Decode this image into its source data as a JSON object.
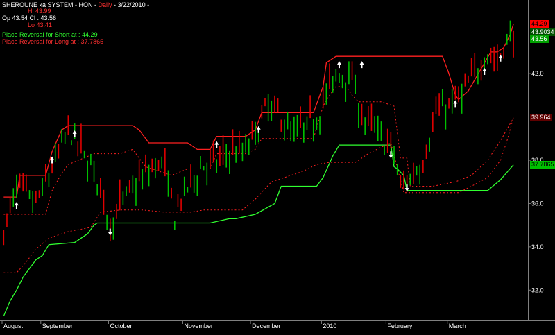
{
  "header": {
    "title_prefix": "SHEROUNE ka SYSTEM - HON - ",
    "title_period": "Daily",
    "title_date": " - 3/22/2010 -",
    "hi": "Hi 43.99",
    "op_cl": "Op 43.54  Cl : 43.56",
    "lo": "Lo 43.41",
    "short_reversal": "Place Reversal for Short at :  44.29",
    "long_reversal": "Place Reversal for Long at :  37.7865"
  },
  "colors": {
    "background": "#000000",
    "up_bar": "#00c000",
    "down_bar": "#e00000",
    "upper_stop": "#ff2020",
    "lower_stop": "#30ff30",
    "axis": "#808080",
    "arrow": "#ffffff"
  },
  "price_tags": [
    {
      "value": 44.29,
      "text": "44.29",
      "bg": "#ff0000",
      "fg": "#000000"
    },
    {
      "value": 43.9034,
      "text": "43.9034",
      "bg": "#005000",
      "fg": "#ffffff"
    },
    {
      "value": 43.56,
      "text": "43.56",
      "bg": "#00a000",
      "fg": "#ffffff"
    },
    {
      "value": 39.964,
      "text": "39.964",
      "bg": "#600000",
      "fg": "#ffffff"
    },
    {
      "value": 37.7865,
      "text": "37.7865",
      "bg": "#00c000",
      "fg": "#000000"
    }
  ],
  "chart_data": {
    "type": "line",
    "ylim": [
      30.6,
      45.4
    ],
    "y_ticks": [
      32.0,
      34.0,
      36.0,
      38.0,
      42.0
    ],
    "y_tick_labels": [
      "32.0",
      "34.0",
      "36.0",
      "38.0",
      "42.0"
    ],
    "num_bars": 163,
    "x_month_labels": [
      {
        "index": 0,
        "label": "August"
      },
      {
        "index": 12,
        "label": "September"
      },
      {
        "index": 33,
        "label": "October"
      },
      {
        "index": 56,
        "label": "November"
      },
      {
        "index": 77,
        "label": "December"
      },
      {
        "index": 99,
        "label": "2010"
      },
      {
        "index": 119,
        "label": "February"
      },
      {
        "index": 138,
        "label": "March"
      }
    ],
    "close_path": [
      {
        "i": 0,
        "v": 34.6
      },
      {
        "i": 4,
        "v": 36.8
      },
      {
        "i": 10,
        "v": 36.0
      },
      {
        "i": 14,
        "v": 37.3
      },
      {
        "i": 20,
        "v": 39.4
      },
      {
        "i": 24,
        "v": 38.5
      },
      {
        "i": 29,
        "v": 37.2
      },
      {
        "i": 33,
        "v": 35.0
      },
      {
        "i": 37,
        "v": 36.2
      },
      {
        "i": 43,
        "v": 37.2
      },
      {
        "i": 49,
        "v": 38.0
      },
      {
        "i": 53,
        "v": 35.5
      },
      {
        "i": 57,
        "v": 36.8
      },
      {
        "i": 62,
        "v": 37.8
      },
      {
        "i": 66,
        "v": 37.9
      },
      {
        "i": 71,
        "v": 38.5
      },
      {
        "i": 74,
        "v": 38.3
      },
      {
        "i": 77,
        "v": 39.0
      },
      {
        "i": 82,
        "v": 40.5
      },
      {
        "i": 86,
        "v": 40.0
      },
      {
        "i": 89,
        "v": 39.2
      },
      {
        "i": 93,
        "v": 39.5
      },
      {
        "i": 97,
        "v": 40.0
      },
      {
        "i": 101,
        "v": 41.4
      },
      {
        "i": 104,
        "v": 42.0
      },
      {
        "i": 108,
        "v": 41.8
      },
      {
        "i": 111,
        "v": 40.0
      },
      {
        "i": 115,
        "v": 39.5
      },
      {
        "i": 118,
        "v": 38.9
      },
      {
        "i": 121,
        "v": 38.4
      },
      {
        "i": 123,
        "v": 36.7
      },
      {
        "i": 126,
        "v": 37.2
      },
      {
        "i": 130,
        "v": 38.0
      },
      {
        "i": 134,
        "v": 40.2
      },
      {
        "i": 138,
        "v": 40.5
      },
      {
        "i": 142,
        "v": 41.0
      },
      {
        "i": 146,
        "v": 42.0
      },
      {
        "i": 150,
        "v": 43.0
      },
      {
        "i": 153,
        "v": 42.5
      },
      {
        "i": 157,
        "v": 43.9
      },
      {
        "i": 158,
        "v": 43.56
      }
    ],
    "series": [
      {
        "role": "upper_stop_solid",
        "points": [
          [
            0,
            36.3
          ],
          [
            4,
            36.3
          ],
          [
            5,
            37.3
          ],
          [
            13,
            37.3
          ],
          [
            15,
            38.4
          ],
          [
            18,
            39.4
          ],
          [
            20,
            39.6
          ],
          [
            40,
            39.6
          ],
          [
            42,
            39.4
          ],
          [
            45,
            38.8
          ],
          [
            52,
            38.8
          ],
          [
            57,
            38.8
          ],
          [
            60,
            38.5
          ],
          [
            64,
            38.5
          ],
          [
            66,
            39.1
          ],
          [
            75,
            39.1
          ],
          [
            78,
            39.4
          ],
          [
            80,
            40.2
          ],
          [
            90,
            40.2
          ],
          [
            96,
            40.2
          ],
          [
            99,
            41.4
          ],
          [
            100,
            42.5
          ],
          [
            103,
            42.8
          ],
          [
            127,
            42.8
          ],
          [
            136,
            42.8
          ],
          [
            138,
            42.0
          ],
          [
            140,
            41.0
          ],
          [
            141,
            40.8
          ],
          [
            144,
            41.2
          ],
          [
            151,
            43.0
          ],
          [
            153,
            43.0
          ],
          [
            155,
            43.2
          ],
          [
            157,
            43.8
          ],
          [
            158,
            44.29
          ]
        ]
      },
      {
        "role": "upper_stop_dotted",
        "points": [
          [
            0,
            35.5
          ],
          [
            13,
            35.5
          ],
          [
            15,
            36.6
          ],
          [
            18,
            37.4
          ],
          [
            20,
            37.8
          ],
          [
            28,
            38.3
          ],
          [
            36,
            38.3
          ],
          [
            40,
            38.5
          ],
          [
            44,
            37.7
          ],
          [
            52,
            37.3
          ],
          [
            57,
            37.6
          ],
          [
            60,
            37.6
          ],
          [
            64,
            37.6
          ],
          [
            66,
            38.3
          ],
          [
            75,
            38.3
          ],
          [
            78,
            38.5
          ],
          [
            80,
            39.0
          ],
          [
            89,
            39.0
          ],
          [
            96,
            39.0
          ],
          [
            99,
            40.5
          ],
          [
            101,
            41.0
          ],
          [
            103,
            41.4
          ],
          [
            106,
            41.4
          ],
          [
            108,
            41.0
          ],
          [
            110,
            40.7
          ],
          [
            117,
            40.7
          ],
          [
            121,
            40.5
          ],
          [
            123,
            38.1
          ],
          [
            125,
            38.1
          ],
          [
            126,
            36.8
          ],
          [
            133,
            36.8
          ],
          [
            140,
            37.0
          ],
          [
            145,
            37.3
          ],
          [
            150,
            38.0
          ],
          [
            154,
            38.9
          ],
          [
            158,
            39.964
          ]
        ]
      },
      {
        "role": "lower_stop_dotted",
        "points": [
          [
            0,
            32.8
          ],
          [
            4,
            32.8
          ],
          [
            7,
            33.3
          ],
          [
            10,
            33.9
          ],
          [
            14,
            34.4
          ],
          [
            20,
            34.7
          ],
          [
            27,
            34.9
          ],
          [
            30,
            35.6
          ],
          [
            36,
            35.7
          ],
          [
            43,
            35.7
          ],
          [
            50,
            35.6
          ],
          [
            54,
            35.6
          ],
          [
            58,
            35.6
          ],
          [
            62,
            35.7
          ],
          [
            68,
            35.7
          ],
          [
            74,
            35.7
          ],
          [
            78,
            36.2
          ],
          [
            83,
            37.0
          ],
          [
            89,
            37.3
          ],
          [
            93,
            37.5
          ],
          [
            97,
            37.8
          ],
          [
            101,
            37.9
          ],
          [
            109,
            37.9
          ],
          [
            113,
            38.3
          ],
          [
            117,
            38.6
          ],
          [
            120,
            38.8
          ],
          [
            124,
            36.5
          ],
          [
            141,
            36.5
          ],
          [
            145,
            36.8
          ],
          [
            150,
            37.2
          ],
          [
            154,
            38.0
          ],
          [
            156,
            38.9
          ],
          [
            158,
            39.964
          ]
        ]
      },
      {
        "role": "lower_stop_solid",
        "points": [
          [
            0,
            30.8
          ],
          [
            2,
            31.5
          ],
          [
            4,
            32.0
          ],
          [
            6,
            32.6
          ],
          [
            10,
            33.4
          ],
          [
            12,
            33.6
          ],
          [
            14,
            34.1
          ],
          [
            22,
            34.2
          ],
          [
            26,
            34.6
          ],
          [
            28,
            35.0
          ],
          [
            29,
            35.1
          ],
          [
            56,
            35.1
          ],
          [
            64,
            35.1
          ],
          [
            70,
            35.3
          ],
          [
            72,
            35.3
          ],
          [
            78,
            35.5
          ],
          [
            84,
            36.0
          ],
          [
            86,
            36.8
          ],
          [
            97,
            36.8
          ],
          [
            99,
            37.2
          ],
          [
            102,
            38.2
          ],
          [
            104,
            38.7
          ],
          [
            120,
            38.7
          ],
          [
            121,
            37.7
          ],
          [
            122,
            37.6
          ],
          [
            124,
            37.3
          ],
          [
            125,
            36.6
          ],
          [
            150,
            36.6
          ],
          [
            154,
            37.1
          ],
          [
            158,
            37.7865
          ]
        ]
      }
    ],
    "buy_arrows": [
      4,
      15,
      22,
      66,
      79,
      104,
      111,
      140,
      149,
      154
    ],
    "sell_arrows": [
      33,
      120,
      125
    ]
  }
}
